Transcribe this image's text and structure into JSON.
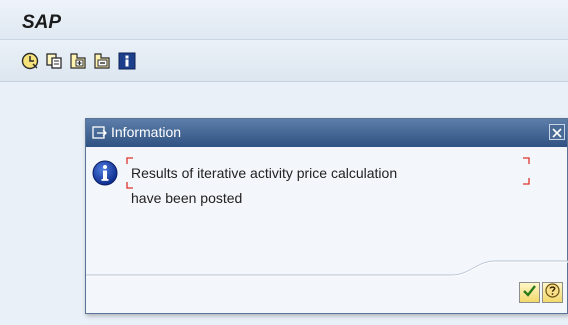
{
  "window": {
    "title": "SAP"
  },
  "toolbar": {
    "buttons": [
      {
        "icon": "execute-clock-icon"
      },
      {
        "icon": "copy-icon"
      },
      {
        "icon": "expand-icon"
      },
      {
        "icon": "collapse-icon"
      },
      {
        "icon": "info-icon"
      }
    ]
  },
  "dialog": {
    "title": "Information",
    "message_line1": "Results of iterative activity price calculation",
    "message_line2": "have been posted",
    "icon": "information-icon",
    "buttons": [
      {
        "icon": "checkmark-icon"
      },
      {
        "icon": "help-icon"
      }
    ]
  },
  "colors": {
    "dialog_header": "#2f5283",
    "background": "#e9f0f7",
    "focus_marker": "#e0332b"
  }
}
